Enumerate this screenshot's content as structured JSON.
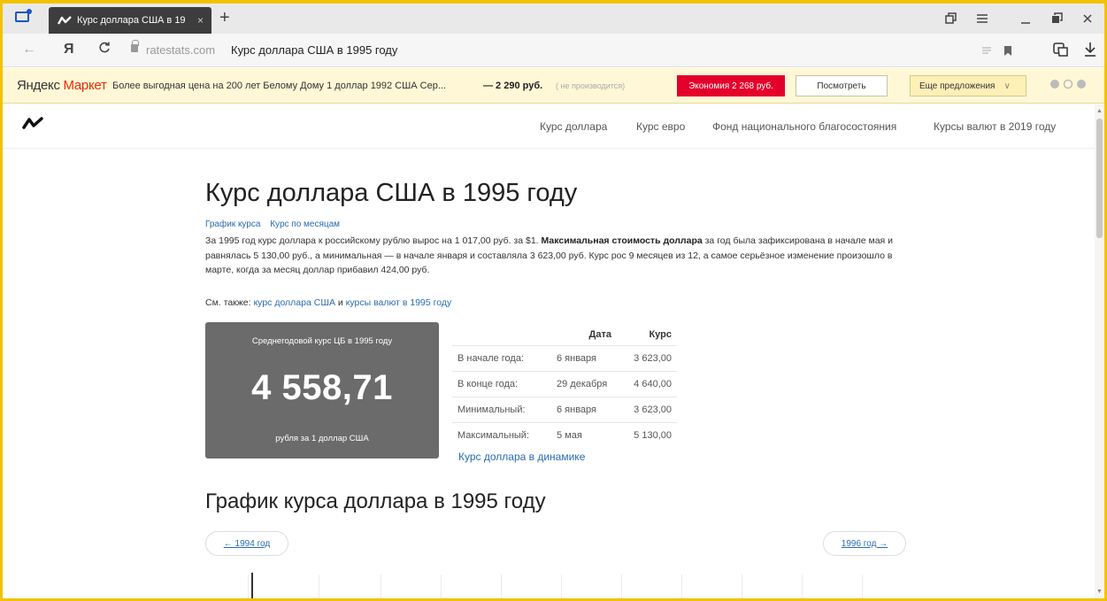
{
  "browser": {
    "tab_title": "Курс доллара США в 19",
    "tab_close": "×",
    "new_tab": "+",
    "url_domain": "ratestats.com",
    "url_title": "Курс доллара США в 1995 году",
    "back": "←",
    "yandex": "Я",
    "reload": "C",
    "icons": [
      "tab-manager-icon",
      "favicon-icon",
      "close-icon",
      "plus-icon",
      "back-icon",
      "yandex-icon",
      "reload-icon",
      "lock-icon",
      "reader-icon",
      "bookmark-icon",
      "extension-icon",
      "download-icon",
      "window-restore-icon",
      "menu-icon",
      "minimize-icon",
      "maximize-icon"
    ]
  },
  "market": {
    "logo_a": "Яндекс",
    "logo_b": "Маркет",
    "offer": "Более выгодная цена на 200 лет Белому Дому 1 доллар 1992 США Сер...",
    "price": "— 2 290 руб.",
    "note": "( не производится)",
    "save": "Экономия 2 268 руб.",
    "look": "Посмотреть",
    "more": "Еще предложения",
    "more_chevron": "∨",
    "colors": {
      "bar_bg": "#fff7d6",
      "save_bg": "#e4002b"
    }
  },
  "site": {
    "nav": [
      "Курс доллара",
      "Курс евро",
      "Фонд национального благосостояния",
      "Курсы валют в 2019 году"
    ]
  },
  "page": {
    "title": "Курс доллара США в 1995 году",
    "sublinks": [
      "График курса",
      "Курс по месяцам"
    ],
    "desc_1": "За 1995 год курс доллара к российскому рублю вырос на 1 017,00 руб. за $1. ",
    "desc_bold": "Максимальная стоимость доллара",
    "desc_2": " за год была зафиксирована в начале мая и равнялась 5 130,00 руб., а минимальная — в начале января и составляла 3 623,00 руб. Курс рос 9 месяцев из 12, а самое серьёзное изменение произошло в марте, когда за месяц доллар прибавил 424,00 руб.",
    "see_also_label": "См. также: ",
    "see_also_link1": "курс доллара США",
    "see_also_and": " и ",
    "see_also_link2": "курсы валют в 1995 году",
    "avg": {
      "caption": "Среднегодовой курс ЦБ в 1995 году",
      "value": "4 558,71",
      "unit": "рубля за 1 доллар США"
    },
    "table": {
      "headers": [
        "",
        "Дата",
        "Курс"
      ],
      "rows": [
        [
          "В начале года:",
          "6 января",
          "3 623,00"
        ],
        [
          "В конце года:",
          "29 декабря",
          "4 640,00"
        ],
        [
          "Минимальный:",
          "6 января",
          "3 623,00"
        ],
        [
          "Максимальный:",
          "5 мая",
          "5 130,00"
        ]
      ]
    },
    "dyn_link": "Курс доллара в динамике",
    "chart_title": "График курса доллара в 1995 году",
    "prev_year": "← 1994 год",
    "next_year": "1996 год →"
  }
}
